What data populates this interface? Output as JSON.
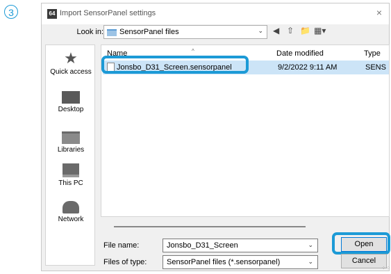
{
  "step_number": "3",
  "dialog": {
    "app_icon_text": "64",
    "title": "Import SensorPanel settings",
    "close_glyph": "×"
  },
  "lookin": {
    "label": "Look in:",
    "value": "SensorPanel files"
  },
  "places": [
    {
      "label": "Quick access",
      "icon": "star-icon"
    },
    {
      "label": "Desktop",
      "icon": "desktop-icon"
    },
    {
      "label": "Libraries",
      "icon": "libraries-icon"
    },
    {
      "label": "This PC",
      "icon": "computer-icon"
    },
    {
      "label": "Network",
      "icon": "network-icon"
    }
  ],
  "columns": {
    "name": "Name",
    "date": "Date modified",
    "type": "Type"
  },
  "files": [
    {
      "name": "Jonsbo_D31_Screen.sensorpanel",
      "date": "9/2/2022 9:11 AM",
      "type": "SENS"
    }
  ],
  "filename": {
    "label": "File name:",
    "value": "Jonsbo_D31_Screen"
  },
  "filetype": {
    "label": "Files of type:",
    "value": "SensorPanel files (*.sensorpanel)"
  },
  "buttons": {
    "open": "Open",
    "cancel": "Cancel"
  },
  "colors": {
    "highlight": "#1c9ad6",
    "selection": "#cce4f7"
  }
}
